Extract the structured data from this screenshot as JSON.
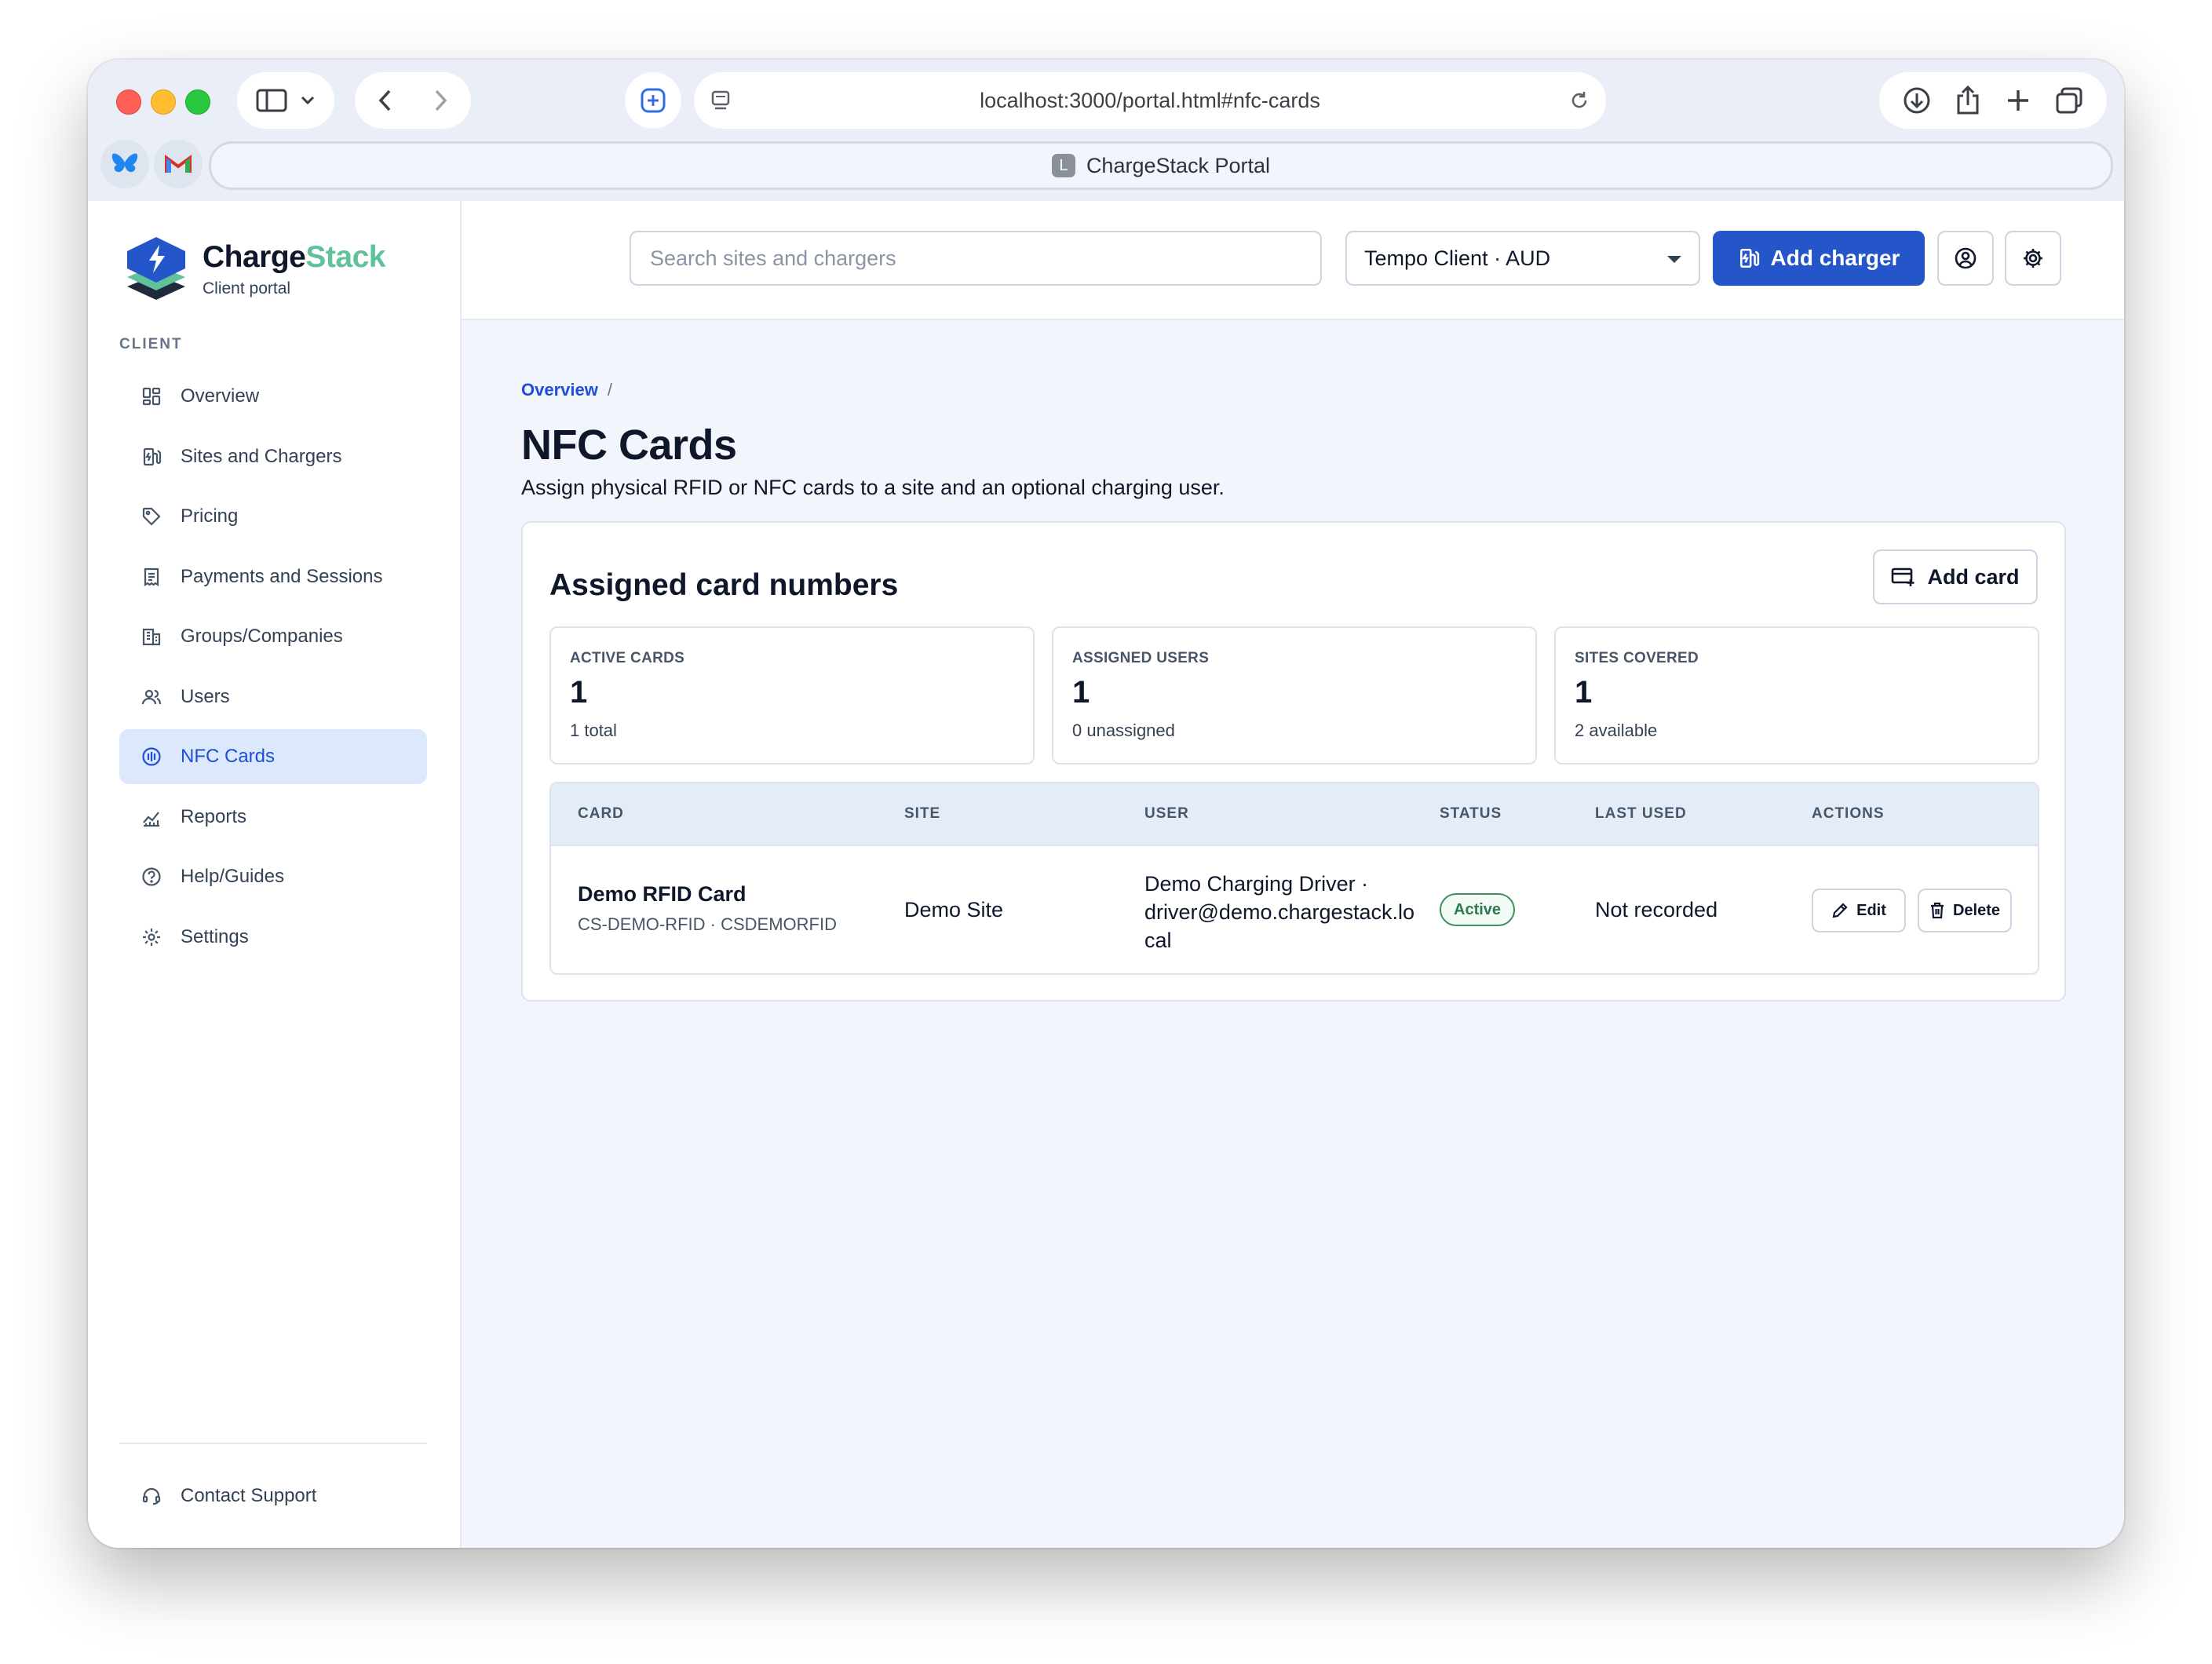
{
  "browser": {
    "url": "localhost:3000/portal.html#nfc-cards",
    "tab_title": "ChargeStack Portal",
    "tab_favicon_letter": "L"
  },
  "brand": {
    "name_primary": "Charge",
    "name_accent": "Stack",
    "subtitle": "Client portal",
    "accent_color": "#5fc29a"
  },
  "sidebar": {
    "section_heading": "CLIENT",
    "items": [
      {
        "label": "Overview",
        "icon": "grid-icon",
        "active": false
      },
      {
        "label": "Sites and Chargers",
        "icon": "charger-icon",
        "active": false
      },
      {
        "label": "Pricing",
        "icon": "tag-icon",
        "active": false
      },
      {
        "label": "Payments and Sessions",
        "icon": "receipt-icon",
        "active": false
      },
      {
        "label": "Groups/Companies",
        "icon": "building-icon",
        "active": false
      },
      {
        "label": "Users",
        "icon": "users-icon",
        "active": false
      },
      {
        "label": "NFC Cards",
        "icon": "nfc-icon",
        "active": true
      },
      {
        "label": "Reports",
        "icon": "chart-icon",
        "active": false
      },
      {
        "label": "Help/Guides",
        "icon": "help-icon",
        "active": false
      },
      {
        "label": "Settings",
        "icon": "gear-icon",
        "active": false
      }
    ],
    "support_label": "Contact Support"
  },
  "topbar": {
    "search_placeholder": "Search sites and chargers",
    "client_select": "Tempo Client · AUD",
    "add_charger_label": "Add charger",
    "primary_color": "#2556c9"
  },
  "page": {
    "breadcrumb": "Overview",
    "breadcrumb_sep": "/",
    "title": "NFC Cards",
    "subtitle": "Assign physical RFID or NFC cards to a site and an optional charging user."
  },
  "panel": {
    "title": "Assigned card numbers",
    "add_card_label": "Add card",
    "stats": [
      {
        "label": "ACTIVE CARDS",
        "value": "1",
        "note": "1 total"
      },
      {
        "label": "ASSIGNED USERS",
        "value": "1",
        "note": "0 unassigned"
      },
      {
        "label": "SITES COVERED",
        "value": "1",
        "note": "2 available"
      }
    ],
    "table": {
      "columns": [
        "CARD",
        "SITE",
        "USER",
        "STATUS",
        "LAST USED",
        "ACTIONS"
      ],
      "rows": [
        {
          "card_name": "Demo RFID Card",
          "card_code": "CS-DEMO-RFID · CSDEMORFID",
          "site": "Demo Site",
          "user_line1": "Demo Charging Driver ·",
          "user_line2": "driver@demo.chargestack.lo",
          "user_line3": "cal",
          "status": "Active",
          "last_used": "Not recorded",
          "edit_label": "Edit",
          "delete_label": "Delete"
        }
      ]
    }
  }
}
